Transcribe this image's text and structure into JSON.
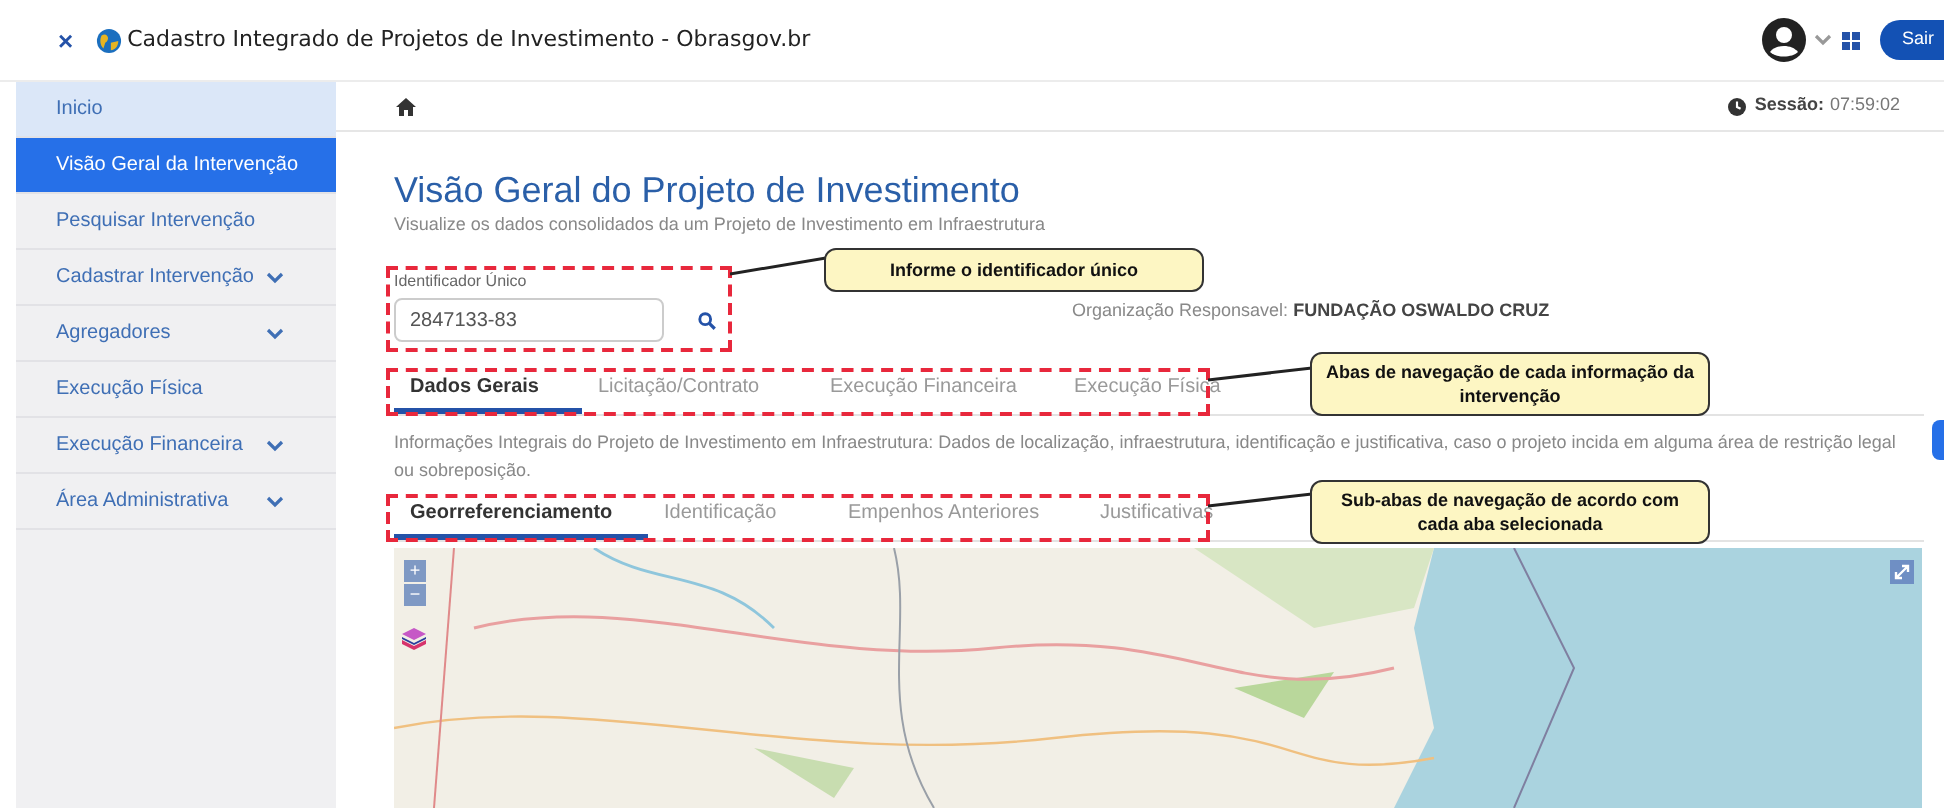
{
  "header": {
    "close": "×",
    "title": "Cadastro Integrado de Projetos de Investimento - Obrasgov.br",
    "logout": "Sair"
  },
  "sidebar": {
    "items": [
      {
        "label": "Inicio",
        "selected": false,
        "highlighted": true,
        "expandable": false
      },
      {
        "label": "Visão Geral da Intervenção",
        "selected": true,
        "highlighted": false,
        "expandable": false
      },
      {
        "label": "Pesquisar Intervenção",
        "selected": false,
        "highlighted": false,
        "expandable": false
      },
      {
        "label": "Cadastrar Intervenção",
        "selected": false,
        "highlighted": false,
        "expandable": true
      },
      {
        "label": "Agregadores",
        "selected": false,
        "highlighted": false,
        "expandable": true
      },
      {
        "label": "Execução Física",
        "selected": false,
        "highlighted": false,
        "expandable": false
      },
      {
        "label": "Execução Financeira",
        "selected": false,
        "highlighted": false,
        "expandable": true
      },
      {
        "label": "Área Administrativa",
        "selected": false,
        "highlighted": false,
        "expandable": true
      }
    ]
  },
  "session": {
    "label": "Sessão:",
    "value": "07:59:02"
  },
  "page": {
    "title": "Visão Geral do Projeto de Investimento",
    "subtitle": "Visualize os dados consolidados da um Projeto de Investimento em Infraestrutura",
    "id_field": {
      "label": "Identificador Único",
      "value": "2847133-83"
    },
    "organization": {
      "label": "Organização Responsavel:",
      "value": "FUNDAÇÃO OSWALDO CRUZ"
    },
    "tabs": [
      {
        "label": "Dados Gerais",
        "selected": true
      },
      {
        "label": "Licitação/Contrato",
        "selected": false
      },
      {
        "label": "Execução Financeira",
        "selected": false
      },
      {
        "label": "Execução Física",
        "selected": false
      }
    ],
    "description": "Informações Integrais do Projeto de Investimento em Infraestrutura: Dados de localização, infraestrutura, identificação e justificativa, caso o projeto incida em alguma área de restrição legal ou sobreposição.",
    "subtabs": [
      {
        "label": "Georreferenciamento",
        "selected": true
      },
      {
        "label": "Identificação",
        "selected": false
      },
      {
        "label": "Empenhos Anteriores",
        "selected": false
      },
      {
        "label": "Justificativas",
        "selected": false
      }
    ],
    "map": {
      "kind": "picture",
      "zoom_in": "+",
      "zoom_out": "−"
    }
  },
  "annotations": [
    {
      "text": "Informe o identificador único"
    },
    {
      "text": "Abas de navegação de cada informação da intervenção"
    },
    {
      "text": "Sub-abas de navegação de acordo com cada aba selecionada"
    }
  ]
}
